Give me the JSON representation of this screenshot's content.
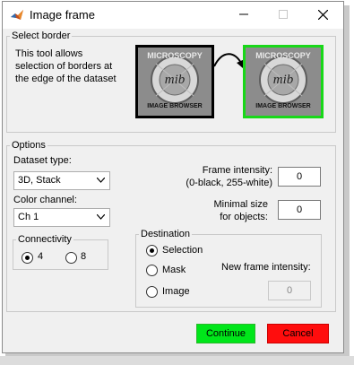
{
  "window": {
    "title": "Image frame"
  },
  "select_border": {
    "title": "Select border",
    "description": [
      "This tool allows",
      "selection of borders at",
      "the edge of the dataset"
    ],
    "logo_text_top": "MICROSCOPY",
    "logo_text_bottom": "IMAGE BROWSER",
    "logo_monogram": "mib"
  },
  "options": {
    "title": "Options",
    "dataset_type": {
      "label": "Dataset type:",
      "value": "3D, Stack"
    },
    "color_channel": {
      "label": "Color channel:",
      "value": "Ch 1"
    },
    "frame_intensity": {
      "label_line1": "Frame intensity:",
      "label_line2": "(0-black, 255-white)",
      "value": "0"
    },
    "minimal_size": {
      "label_line1": "Minimal size",
      "label_line2": "for objects:",
      "value": "0"
    },
    "connectivity": {
      "title": "Connectivity",
      "options": [
        {
          "label": "4",
          "checked": true
        },
        {
          "label": "8",
          "checked": false
        }
      ]
    },
    "destination": {
      "title": "Destination",
      "options": [
        {
          "label": "Selection",
          "checked": true
        },
        {
          "label": "Mask",
          "checked": false
        },
        {
          "label": "Image",
          "checked": false
        }
      ],
      "new_frame_intensity": {
        "label": "New frame intensity:",
        "value": "0"
      }
    }
  },
  "buttons": {
    "continue": {
      "label": "Continue",
      "color": "#00e61a"
    },
    "cancel": {
      "label": "Cancel",
      "color": "#ff0d0d"
    }
  },
  "colors": {
    "selected_border": "#18d818",
    "logo_border": "#000000"
  }
}
